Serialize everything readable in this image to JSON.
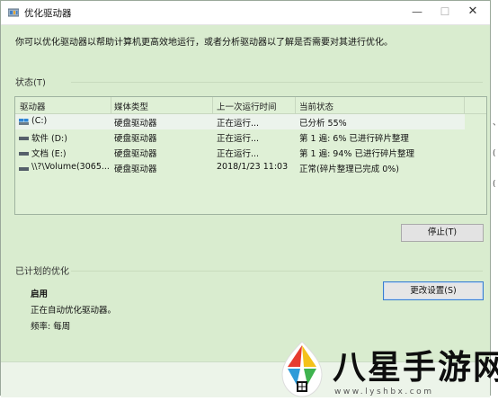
{
  "window": {
    "title": "优化驱动器",
    "controls": {
      "minimize": "—",
      "maximize": "☐",
      "close": "✕"
    }
  },
  "description": "你可以优化驱动器以帮助计算机更高效地运行，或者分析驱动器以了解是否需要对其进行优化。",
  "status_section": {
    "label": "状态(T)"
  },
  "drive_list": {
    "columns": [
      "驱动器",
      "媒体类型",
      "上一次运行时间",
      "当前状态"
    ],
    "rows": [
      {
        "drive": "(C:)",
        "media": "硬盘驱动器",
        "last_run": "正在运行...",
        "status": "已分析 55%",
        "icon": "system-drive-icon",
        "selected": true
      },
      {
        "drive": "软件 (D:)",
        "media": "硬盘驱动器",
        "last_run": "正在运行...",
        "status": "第 1 遍: 6% 已进行碎片整理",
        "icon": "drive-icon",
        "selected": false
      },
      {
        "drive": "文档 (E:)",
        "media": "硬盘驱动器",
        "last_run": "正在运行...",
        "status": "第 1 遍: 94% 已进行碎片整理",
        "icon": "drive-icon",
        "selected": false
      },
      {
        "drive": "\\\\?\\Volume(3065...",
        "media": "硬盘驱动器",
        "last_run": "2018/1/23 11:03",
        "status": "正常(碎片整理已完成 0%)",
        "icon": "drive-icon",
        "selected": false
      }
    ]
  },
  "buttons": {
    "stop": "停止(T)",
    "change_settings": "更改设置(S)"
  },
  "scheduled_section": {
    "label": "已计划的优化",
    "state": "启用",
    "detail": "正在自动优化驱动器。",
    "frequency": "频率: 每周"
  },
  "watermark": {
    "title": "八星手游网",
    "url": "www.lyshbx.com"
  },
  "edge_marks": [
    "、",
    "(",
    "("
  ],
  "colors": {
    "window_bg": "#d9eccf",
    "accent_border": "#3a7ed0"
  }
}
